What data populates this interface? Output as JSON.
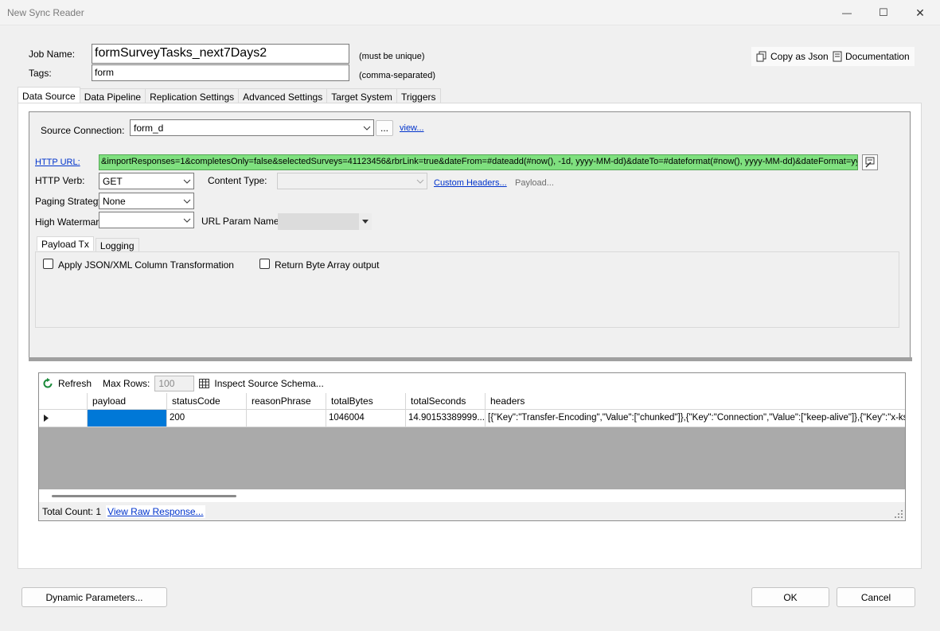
{
  "window": {
    "title": "New Sync Reader",
    "minimize_glyph": "—",
    "maximize_glyph": "☐",
    "close_glyph": "✕"
  },
  "job": {
    "name_label": "Job Name:",
    "name_value": "formSurveyTasks_next7Days2",
    "name_hint": "(must be unique)",
    "tags_label": "Tags:",
    "tags_value": "form",
    "tags_hint": "(comma-separated)"
  },
  "top_actions": {
    "copy_json": "Copy as Json",
    "documentation": "Documentation"
  },
  "tabs": [
    "Data Source",
    "Data Pipeline",
    "Replication Settings",
    "Advanced Settings",
    "Target System",
    "Triggers"
  ],
  "source": {
    "connection_label": "Source Connection:",
    "connection_value": "form_d",
    "browse_label": "...",
    "view_link": "view...",
    "http_url_label": "HTTP URL:",
    "http_url_value": "&importResponses=1&completesOnly=false&selectedSurveys=41123456&rbrLink=true&dateFrom=#dateadd(#now(), -1d, yyyy-MM-dd)&dateTo=#dateformat(#now(), yyyy-MM-dd)&dateFormat=yyyy-MM-dd",
    "http_verb_label": "HTTP Verb:",
    "http_verb_value": "GET",
    "content_type_label": "Content Type:",
    "content_type_value": "",
    "custom_headers_link": "Custom Headers...",
    "payload_label": "Payload...",
    "paging_label": "Paging Strategy:",
    "paging_value": "None",
    "watermark_label": "High Watermark:",
    "watermark_value": "",
    "url_param_label": "URL Param Name:",
    "url_param_value": ""
  },
  "subtabs": [
    "Payload Tx",
    "Logging"
  ],
  "payload": {
    "apply_json_label": "Apply JSON/XML Column Transformation",
    "apply_json_checked": false,
    "return_byte_label": "Return Byte Array output",
    "return_byte_checked": false
  },
  "grid": {
    "refresh_label": "Refresh",
    "max_rows_label": "Max Rows:",
    "max_rows_value": "100",
    "inspect_label": "Inspect Source Schema...",
    "columns": [
      "payload",
      "statusCode",
      "reasonPhrase",
      "totalBytes",
      "totalSeconds",
      "headers"
    ],
    "row": {
      "payload": "",
      "statusCode": "200",
      "reasonPhrase": "",
      "totalBytes": "1046004",
      "totalSeconds": "14.90153389999...",
      "headers": "[{\"Key\":\"Transfer-Encoding\",\"Value\":[\"chunked\"]},{\"Key\":\"Connection\",\"Value\":[\"keep-alive\"]},{\"Key\":\"x-ks-s"
    },
    "total_count": "Total Count: 1",
    "view_raw_link": "View Raw Response..."
  },
  "footer": {
    "dynamic_params": "Dynamic Parameters...",
    "ok": "OK",
    "cancel": "Cancel"
  },
  "colors": {
    "url_bg": "#7fe07f",
    "selected_cell": "#0078d7",
    "link": "#0033cc"
  }
}
